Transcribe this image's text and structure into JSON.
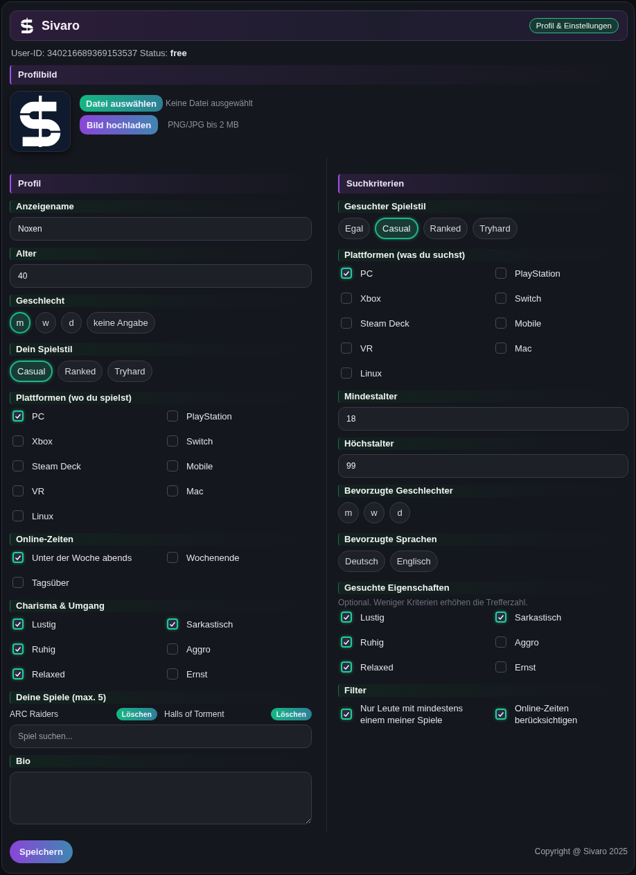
{
  "header": {
    "brand": "Sivaro",
    "button": "Profil & Einstellungen"
  },
  "user_line": "User-ID: 340216689369153537 Status: **free**",
  "profile_picture": {
    "title": "Profilbild",
    "choose_button": "Datei auswählen",
    "file_status": "Keine Datei ausgewählt",
    "upload_button": "Bild hochladen",
    "hint": "PNG/JPG bis 2 MB"
  },
  "columns": [
    {
      "title": "Profil",
      "fields": [
        {
          "kind": "text",
          "label": "Anzeigename",
          "value": "Noxen"
        },
        {
          "kind": "text",
          "label": "Alter",
          "value": "40"
        },
        {
          "kind": "chips",
          "label": "Geschlecht",
          "options": [
            {
              "label": "m",
              "selected": true
            },
            {
              "label": "w",
              "selected": false
            },
            {
              "label": "d",
              "selected": false
            },
            {
              "label": "keine Angabe",
              "selected": false
            }
          ]
        },
        {
          "kind": "chips",
          "label": "Dein Spielstil",
          "options": [
            {
              "label": "Casual",
              "selected": true
            },
            {
              "label": "Ranked",
              "selected": false
            },
            {
              "label": "Tryhard",
              "selected": false
            }
          ]
        },
        {
          "kind": "checks",
          "label": "Plattformen (wo du spielst)",
          "options": [
            {
              "label": "PC",
              "checked": true
            },
            {
              "label": "PlayStation",
              "checked": false
            },
            {
              "label": "Xbox",
              "checked": false
            },
            {
              "label": "Switch",
              "checked": false
            },
            {
              "label": "Steam Deck",
              "checked": false
            },
            {
              "label": "Mobile",
              "checked": false
            },
            {
              "label": "VR",
              "checked": false
            },
            {
              "label": "Mac",
              "checked": false
            },
            {
              "label": "Linux",
              "checked": false
            }
          ]
        },
        {
          "kind": "checks",
          "label": "Online-Zeiten",
          "options": [
            {
              "label": "Unter der Woche abends",
              "checked": true
            },
            {
              "label": "Wochenende",
              "checked": false
            },
            {
              "label": "Tagsüber",
              "checked": false
            }
          ]
        },
        {
          "kind": "checks",
          "label": "Charisma & Umgang",
          "options": [
            {
              "label": "Lustig",
              "checked": true
            },
            {
              "label": "Sarkastisch",
              "checked": true
            },
            {
              "label": "Ruhig",
              "checked": true
            },
            {
              "label": "Aggro",
              "checked": false
            },
            {
              "label": "Relaxed",
              "checked": true
            },
            {
              "label": "Ernst",
              "checked": false
            }
          ]
        },
        {
          "kind": "games",
          "label": "Deine Spiele (max. 5)",
          "games": [
            {
              "name": "ARC Raiders",
              "button": "Löschen"
            },
            {
              "name": "Halls of Torment",
              "button": "Löschen"
            }
          ],
          "placeholder": "Spiel suchen..."
        },
        {
          "kind": "textarea",
          "label": "Bio"
        }
      ]
    },
    {
      "title": "Suchkriterien",
      "fields": [
        {
          "kind": "chips",
          "label": "Gesuchter Spielstil",
          "options": [
            {
              "label": "Egal",
              "selected": false
            },
            {
              "label": "Casual",
              "selected": true
            },
            {
              "label": "Ranked",
              "selected": false
            },
            {
              "label": "Tryhard",
              "selected": false
            }
          ]
        },
        {
          "kind": "checks",
          "label": "Plattformen (was du suchst)",
          "options": [
            {
              "label": "PC",
              "checked": true
            },
            {
              "label": "PlayStation",
              "checked": false
            },
            {
              "label": "Xbox",
              "checked": false
            },
            {
              "label": "Switch",
              "checked": false
            },
            {
              "label": "Steam Deck",
              "checked": false
            },
            {
              "label": "Mobile",
              "checked": false
            },
            {
              "label": "VR",
              "checked": false
            },
            {
              "label": "Mac",
              "checked": false
            },
            {
              "label": "Linux",
              "checked": false
            }
          ]
        },
        {
          "kind": "text",
          "label": "Mindestalter",
          "value": "18"
        },
        {
          "kind": "text",
          "label": "Höchstalter",
          "value": "99"
        },
        {
          "kind": "chips",
          "label": "Bevorzugte Geschlechter",
          "options": [
            {
              "label": "m",
              "selected": false
            },
            {
              "label": "w",
              "selected": false
            },
            {
              "label": "d",
              "selected": false
            }
          ]
        },
        {
          "kind": "chips",
          "label": "Bevorzugte Sprachen",
          "options": [
            {
              "label": "Deutsch",
              "selected": false
            },
            {
              "label": "Englisch",
              "selected": false
            }
          ]
        },
        {
          "kind": "checks",
          "label": "Gesuchte Eigenschaften",
          "note": "Optional. Weniger Kriterien erhöhen die Trefferzahl.",
          "options": [
            {
              "label": "Lustig",
              "checked": true
            },
            {
              "label": "Sarkastisch",
              "checked": true
            },
            {
              "label": "Ruhig",
              "checked": true
            },
            {
              "label": "Aggro",
              "checked": false
            },
            {
              "label": "Relaxed",
              "checked": true
            },
            {
              "label": "Ernst",
              "checked": false
            }
          ]
        },
        {
          "kind": "checks",
          "label": "Filter",
          "options": [
            {
              "label": "Nur Leute mit mindestens einem meiner Spiele",
              "checked": true
            },
            {
              "label": "Online-Zeiten berücksichtigen",
              "checked": true
            }
          ]
        }
      ]
    }
  ],
  "save_button": "Speichern",
  "copyright": "Copyright @ Sivaro 2025"
}
